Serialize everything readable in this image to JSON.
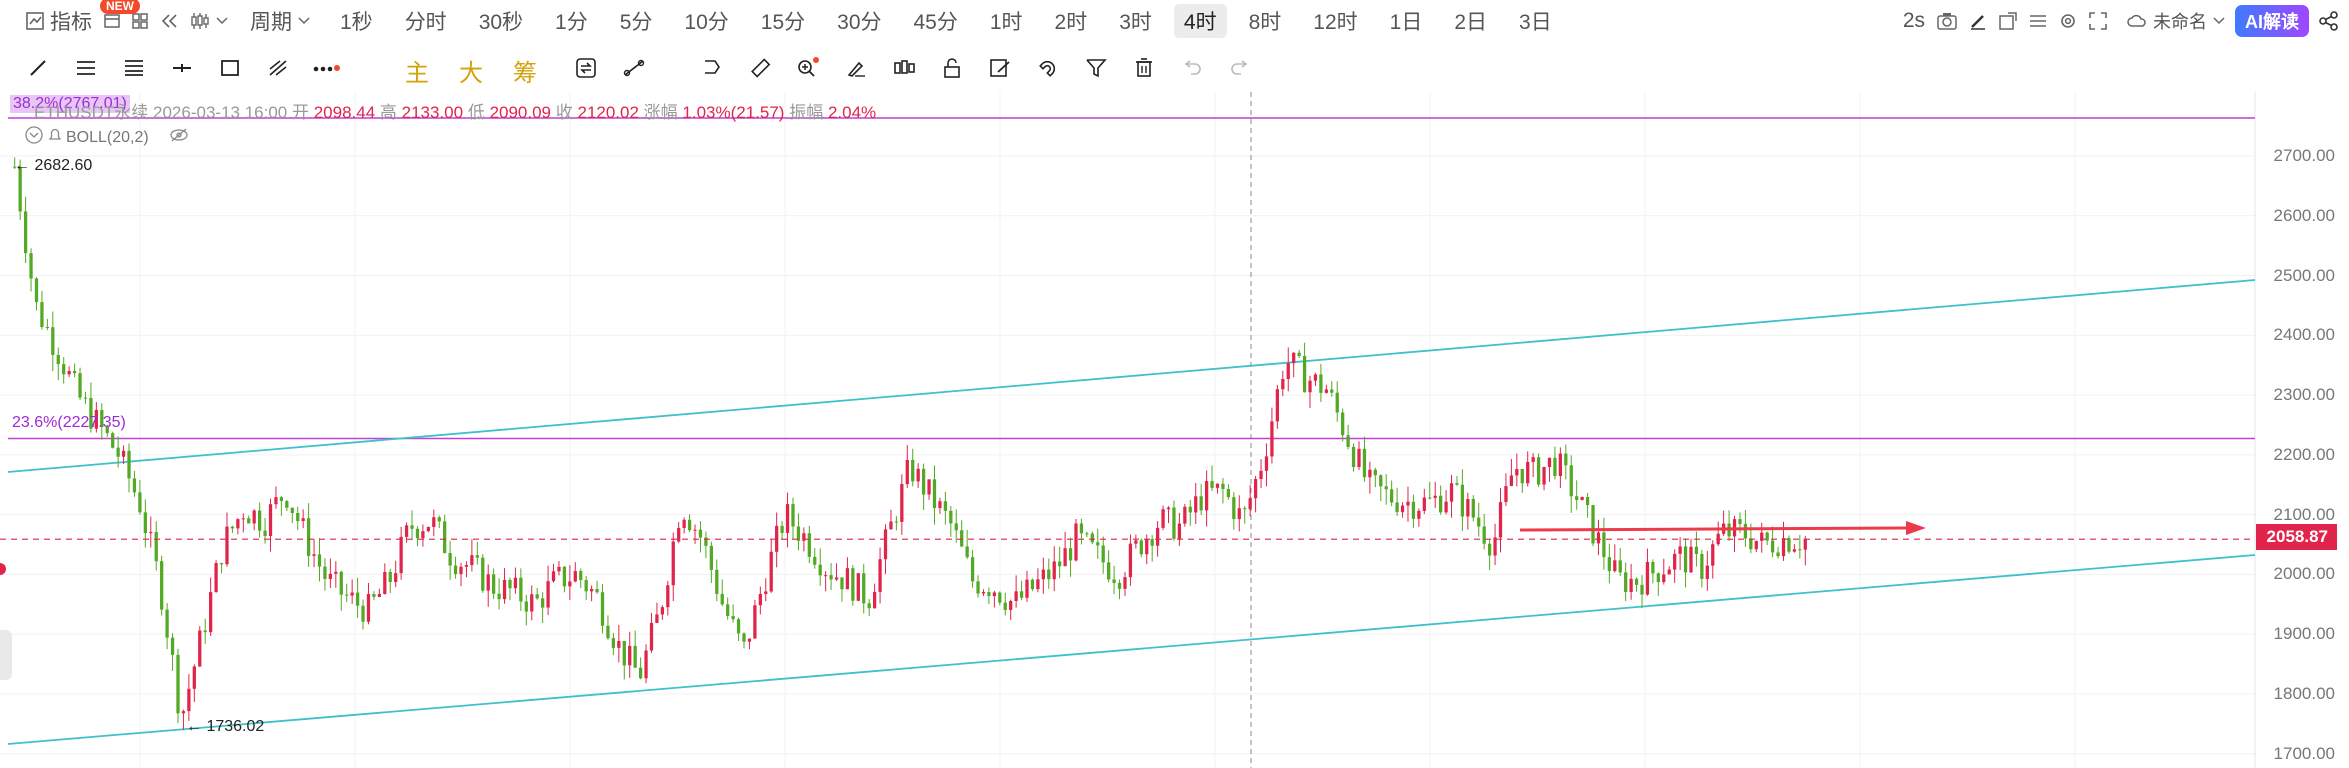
{
  "toolbar": {
    "indicator_label": "指标",
    "new_badge": "NEW",
    "period_label": "周期",
    "periods": [
      "1秒",
      "分时",
      "30秒",
      "1分",
      "5分",
      "10分",
      "15分",
      "30分",
      "45分",
      "1时",
      "2时",
      "3时",
      "4时",
      "8时",
      "12时",
      "1日",
      "2日",
      "3日"
    ],
    "active_period": "4时",
    "interval_value": "2s",
    "layout_name": "未命名",
    "ai_button": "AI解读"
  },
  "drawing_tools": {
    "text_tools": [
      "主",
      "大",
      "筹"
    ]
  },
  "legend": {
    "symbol": "ETHUSDT永续",
    "datetime": "2026-03-13 16:00",
    "open_label": "开",
    "open": "2098.44",
    "high_label": "高",
    "high": "2133.00",
    "low_label": "低",
    "low": "2090.09",
    "close_label": "收",
    "close": "2120.02",
    "change_label": "涨幅",
    "change": "1.03%(21.57)",
    "amplitude_label": "振幅",
    "amplitude": "2.04%",
    "indicator": "BOLL(20,2)"
  },
  "fib_levels": {
    "level_382": "38.2%(2767.01)",
    "level_236": "23.6%(2227.35)"
  },
  "annotations": {
    "high_marker": "2682.60",
    "low_marker": "1736.02"
  },
  "chart_data": {
    "type": "candlestick",
    "symbol": "ETHUSDT",
    "timeframe": "4时",
    "ylim": [
      1680,
      2780
    ],
    "y_ticks": [
      "2700.00",
      "2600.00",
      "2500.00",
      "2400.00",
      "2300.00",
      "2200.00",
      "2100.00",
      "2000.00",
      "1900.00",
      "1800.00",
      "1700.00"
    ],
    "current_price": "2058.87",
    "horizontal_lines": [
      {
        "label": "38.2%(2767.01)",
        "value": 2767.01,
        "color": "#c23ed8"
      },
      {
        "label": "23.6%(2227.35)",
        "value": 2227.35,
        "color": "#c23ed8"
      }
    ],
    "channel_color": "#3fc1c9",
    "up_color": "#e0244b",
    "down_color": "#52a923",
    "ohlc_path": [
      2682,
      2450,
      2380,
      2300,
      2250,
      2200,
      2120,
      1980,
      1760,
      1900,
      2050,
      2110,
      2090,
      2140,
      2060,
      1990,
      1960,
      1940,
      1990,
      2080,
      2090,
      2030,
      2010,
      1980,
      1970,
      1950,
      1990,
      2000,
      1960,
      1880,
      1830,
      1940,
      2120,
      2060,
      1950,
      1870,
      1990,
      2100,
      2060,
      2010,
      1990,
      1960,
      2070,
      2180,
      2130,
      2080,
      1990,
      1980,
      1950,
      1980,
      2010,
      2060,
      2030,
      2000,
      2050,
      2090,
      2080,
      2130,
      2140,
      2090,
      2200,
      2360,
      2330,
      2310,
      2230,
      2150,
      2130,
      2120,
      2120,
      2140,
      2100,
      2050,
      2180,
      2170,
      2190,
      2130,
      2060,
      1990,
      1990,
      2010,
      2030,
      2010,
      2070,
      2070,
      2050,
      2060,
      2058
    ]
  },
  "colors": {
    "fib_line": "#c23ed8",
    "channel": "#3fc1c9",
    "price_tag": "#e0244b",
    "arrow": "#ee3b4b",
    "ai_gradient_start": "#3f7bff",
    "ai_gradient_end": "#a046ff"
  }
}
